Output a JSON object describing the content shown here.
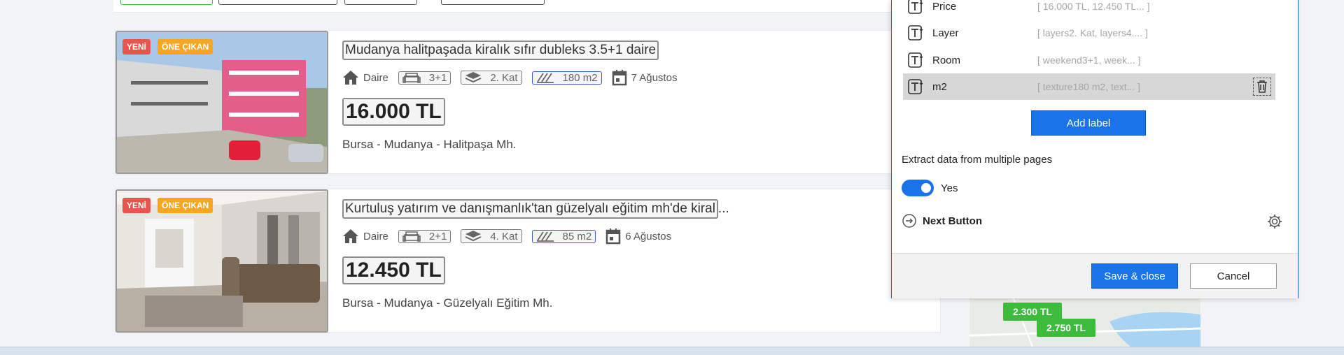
{
  "listings": [
    {
      "badge_new": "YENİ",
      "badge_featured": "ÖNE ÇIKAN",
      "title": "Mudanya halitpaşada kiralık sıfır dubleks 3.5+1 daire",
      "type": "Daire",
      "rooms": "3+1",
      "floor": "2. Kat",
      "area": "180 m2",
      "date": "7 Ağustos",
      "price": "16.000 TL",
      "location": "Bursa - Mudanya - Halitpaşa Mh."
    },
    {
      "badge_new": "YENİ",
      "badge_featured": "ÖNE ÇIKAN",
      "title": "Kurtuluş yatırım ve danışmanlık'tan güzelyalı eğitim mh'de kiral",
      "title_suffix": "...",
      "type": "Daire",
      "rooms": "2+1",
      "floor": "4. Kat",
      "area": "85 m2",
      "date": "6 Ağustos",
      "price": "12.450 TL",
      "location": "Bursa - Mudanya - Güzelyalı Eğitim Mh."
    }
  ],
  "map": {
    "pins": [
      "2.300 TL",
      "2.750 TL"
    ],
    "pin_color": "#3dbb3d"
  },
  "panel": {
    "fields": [
      {
        "name": "Price",
        "value": "[ 16.000 TL, 12.450 TL... ]"
      },
      {
        "name": "Layer",
        "value": "[ layers2. Kat, layers4.... ]"
      },
      {
        "name": "Room",
        "value": "[ weekend3+1, week... ]"
      },
      {
        "name": "m2",
        "value": "[ texture180 m2, text... ]",
        "selected": true
      }
    ],
    "add_label": "Add label",
    "multi_page_title": "Extract data from multiple pages",
    "toggle_state": "Yes",
    "next_button_label": "Next Button",
    "save_label": "Save & close",
    "cancel_label": "Cancel",
    "accent": "#1a73e8"
  },
  "badge_colors": {
    "new": "#e8554e",
    "featured": "#f5a623"
  }
}
